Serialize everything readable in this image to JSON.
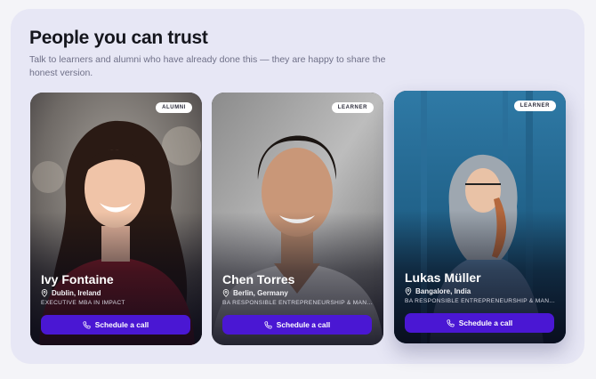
{
  "section": {
    "title": "People you can trust",
    "subtitle": "Talk to learners and alumni who have already done this — they are happy to share the honest version."
  },
  "cards": [
    {
      "badge": "ALUMNI",
      "name": "Ivy Fontaine",
      "location": "Dublin, Ireland",
      "program": "EXECUTIVE MBA IN IMPACT",
      "button": "Schedule a call"
    },
    {
      "badge": "LEARNER",
      "name": "Chen Torres",
      "location": "Berlin, Germany",
      "program": "BA RESPONSIBLE ENTREPRENEURSHIP & MANAGEMENT",
      "button": "Schedule a call"
    },
    {
      "badge": "LEARNER",
      "name": "Lukas Müller",
      "location": "Bangalore, India",
      "program": "BA RESPONSIBLE ENTREPRENEURSHIP & MANAGEMENT",
      "button": "Schedule a call"
    }
  ],
  "icons": {
    "location": "map-pin-icon",
    "call": "phone-icon"
  },
  "colors": {
    "button": "#4a17d3",
    "panel": "#e7e7f5"
  }
}
